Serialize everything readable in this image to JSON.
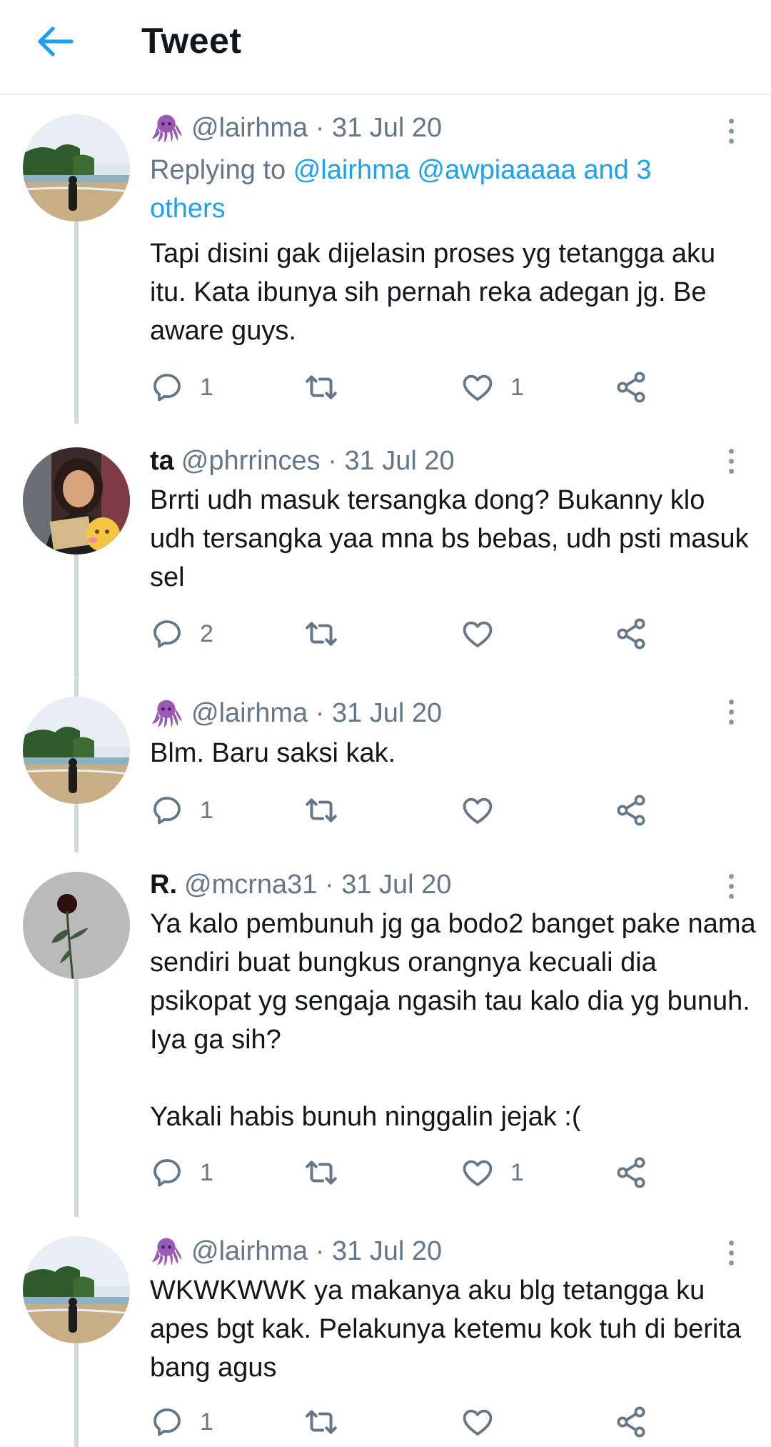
{
  "header": {
    "title": "Tweet",
    "back_icon": "arrow-left-icon"
  },
  "colors": {
    "accent": "#1da1f2",
    "secondary_text": "#657786",
    "thread_line": "#cfd9de"
  },
  "tweets": [
    {
      "name": "",
      "emoji": "octopus",
      "handle": "@lairhma",
      "date": "31 Jul 20",
      "reply_prefix": "Replying to",
      "reply_mentions": "@lairhma @awpiaaaaa and 3 others",
      "text": "Tapi disini gak dijelasin proses yg tetangga aku itu. Kata ibunya sih pernah reka adegan jg. Be aware guys.",
      "replies": "1",
      "retweets": "",
      "likes": "1"
    },
    {
      "name": "ta",
      "handle": "@phrrinces",
      "date": "31 Jul 20",
      "text": "Brrti udh masuk tersangka dong? Bukanny klo udh tersangka yaa mna bs bebas, udh psti masuk sel",
      "replies": "2",
      "retweets": "",
      "likes": ""
    },
    {
      "name": "",
      "emoji": "octopus",
      "handle": "@lairhma",
      "date": "31 Jul 20",
      "text": "Blm. Baru saksi kak.",
      "replies": "1",
      "retweets": "",
      "likes": ""
    },
    {
      "name": "R.",
      "handle": "@mcrna31",
      "date": "31 Jul 20",
      "text": "Ya kalo pembunuh jg ga bodo2 banget pake nama sendiri buat bungkus orangnya kecuali dia psikopat yg sengaja ngasih tau kalo dia yg bunuh. Iya ga sih?\n\nYakali habis bunuh ninggalin jejak :(",
      "replies": "1",
      "retweets": "",
      "likes": "1"
    },
    {
      "name": "",
      "emoji": "octopus",
      "handle": "@lairhma",
      "date": "31 Jul 20",
      "text": "WKWKWWK ya makanya aku blg tetangga ku apes bgt kak. Pelakunya ketemu kok tuh di berita bang agus",
      "replies": "1",
      "retweets": "",
      "likes": ""
    }
  ]
}
